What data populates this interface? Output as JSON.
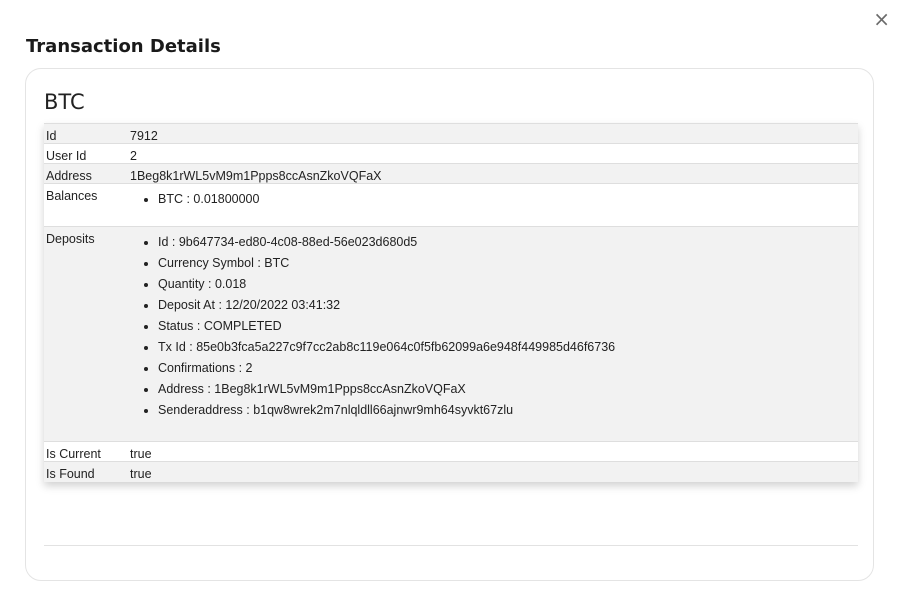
{
  "modal": {
    "title": "Transaction Details",
    "close_label": "×"
  },
  "card": {
    "title": "BTC"
  },
  "details": {
    "id_label": "Id",
    "id_value": "7912",
    "user_id_label": "User Id",
    "user_id_value": "2",
    "address_label": "Address",
    "address_value": "1Beg8k1rWL5vM9m1Ppps8ccAsnZkoVQFaX",
    "balances_label": "Balances",
    "balances": [
      "BTC : 0.01800000"
    ],
    "deposits_label": "Deposits",
    "deposits": [
      "Id : 9b647734-ed80-4c08-88ed-56e023d680d5",
      "Currency Symbol : BTC",
      "Quantity : 0.018",
      "Deposit At : 12/20/2022 03:41:32",
      "Status : COMPLETED",
      "Tx Id : 85e0b3fca5a227c9f7cc2ab8c119e064c0f5fb62099a6e948f449985d46f6736",
      "Confirmations : 2",
      "Address : 1Beg8k1rWL5vM9m1Ppps8ccAsnZkoVQFaX",
      "Senderaddress : b1qw8wrek2m7nlqldll66ajnwr9mh64syvkt67zlu"
    ],
    "is_current_label": "Is Current",
    "is_current_value": "true",
    "is_found_label": "Is Found",
    "is_found_value": "true"
  }
}
